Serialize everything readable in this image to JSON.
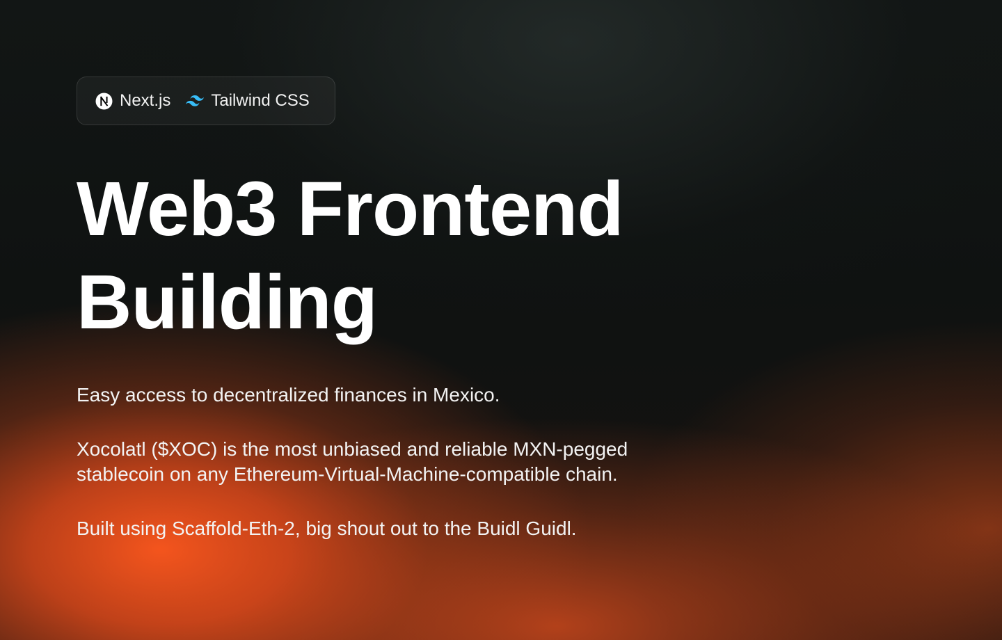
{
  "badge": {
    "items": [
      {
        "label": "Next.js",
        "icon": "nextjs-logo-icon"
      },
      {
        "label": "Tailwind CSS",
        "icon": "tailwind-logo-icon",
        "color": "#38bdf8"
      }
    ]
  },
  "hero": {
    "title_line1": "Web3 Frontend",
    "title_line2": "Building"
  },
  "description": {
    "tagline": "Easy access to decentralized finances in Mexico.",
    "xoc_line1": "Xocolatl ($XOC) is the most unbiased and reliable MXN-pegged",
    "xoc_line2": "stablecoin on any Ethereum-Virtual-Machine-compatible chain.",
    "credits": "Built using Scaffold-Eth-2, big shout out to the Buidl Guidl."
  },
  "theme": {
    "background": "#101312",
    "accent_orange": "#f55a24"
  }
}
